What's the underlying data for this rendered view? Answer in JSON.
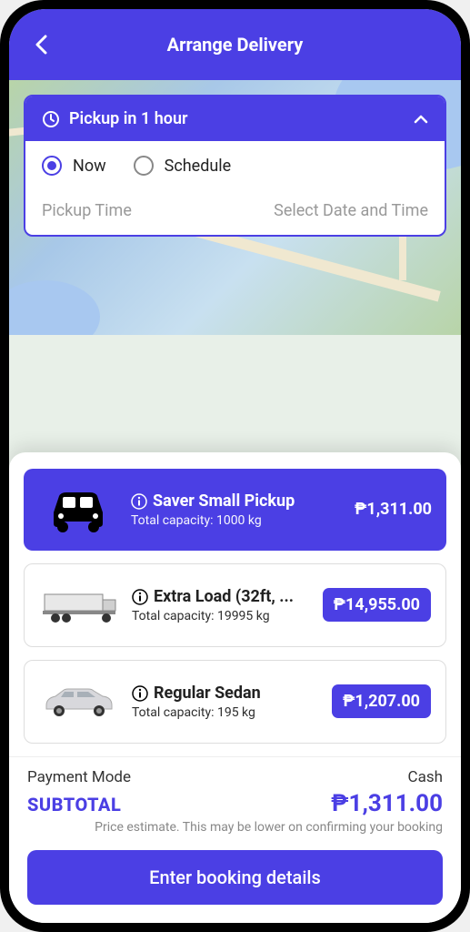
{
  "header": {
    "title": "Arrange Delivery"
  },
  "pickup": {
    "header_text": "Pickup in 1 hour",
    "options": {
      "now": "Now",
      "schedule": "Schedule"
    },
    "time_label": "Pickup Time",
    "dt_placeholder": "Select Date and Time"
  },
  "vehicles": [
    {
      "name": "Saver Small Pickup",
      "capacity": "Total capacity: 1000 kg",
      "price": "₱1,311.00",
      "selected": true
    },
    {
      "name": "Extra Load (32ft, ...",
      "capacity": "Total capacity: 19995 kg",
      "price": "₱14,955.00",
      "selected": false
    },
    {
      "name": "Regular Sedan",
      "capacity": "Total capacity: 195 kg",
      "price": "₱1,207.00",
      "selected": false
    }
  ],
  "footer": {
    "payment_label": "Payment Mode",
    "payment_value": "Cash",
    "subtotal_label": "SUBTOTAL",
    "subtotal_value": "₱1,311.00",
    "note": "Price estimate. This may be lower on confirming your booking",
    "cta": "Enter booking details"
  }
}
